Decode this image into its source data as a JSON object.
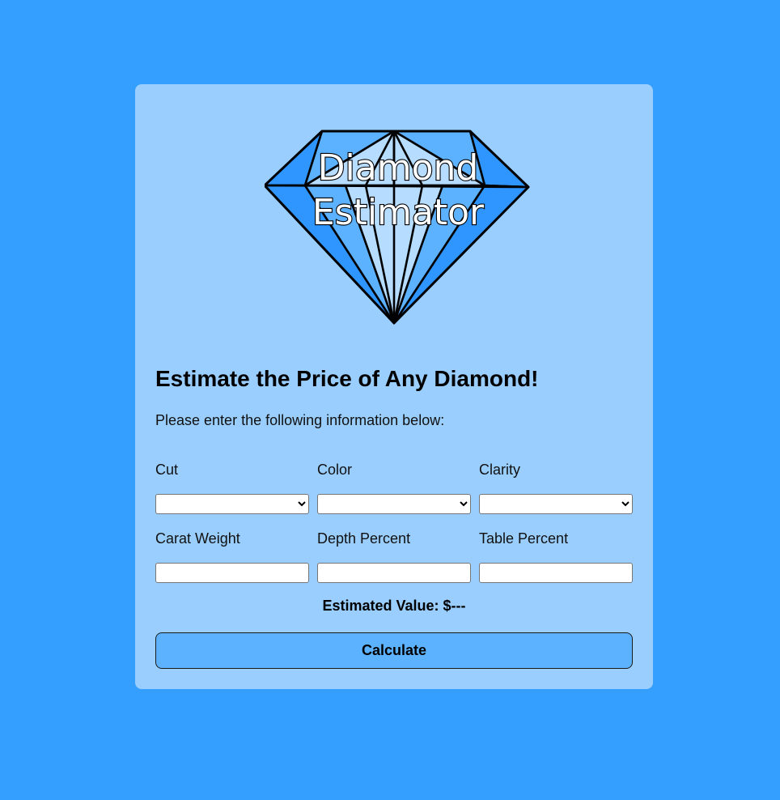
{
  "logo": {
    "line1": "Diamond",
    "line2": "Estimator",
    "colors": {
      "dark_facet": "#2f95ff",
      "mid_facet": "#5db2ff",
      "light_facet": "#b6dcff",
      "outline": "#000000"
    }
  },
  "heading": "Estimate the Price of Any Diamond!",
  "subtext": "Please enter the following information below:",
  "fields": {
    "cut": {
      "label": "Cut",
      "value": ""
    },
    "color": {
      "label": "Color",
      "value": ""
    },
    "clarity": {
      "label": "Clarity",
      "value": ""
    },
    "carat_weight": {
      "label": "Carat Weight",
      "value": ""
    },
    "depth_percent": {
      "label": "Depth Percent",
      "value": ""
    },
    "table_percent": {
      "label": "Table Percent",
      "value": ""
    }
  },
  "estimate_text": "Estimated Value: $---",
  "calculate_label": "Calculate",
  "colors": {
    "page_background": "#349ffe",
    "card_background": "#99ceff",
    "button_background": "#5cb2ff"
  }
}
